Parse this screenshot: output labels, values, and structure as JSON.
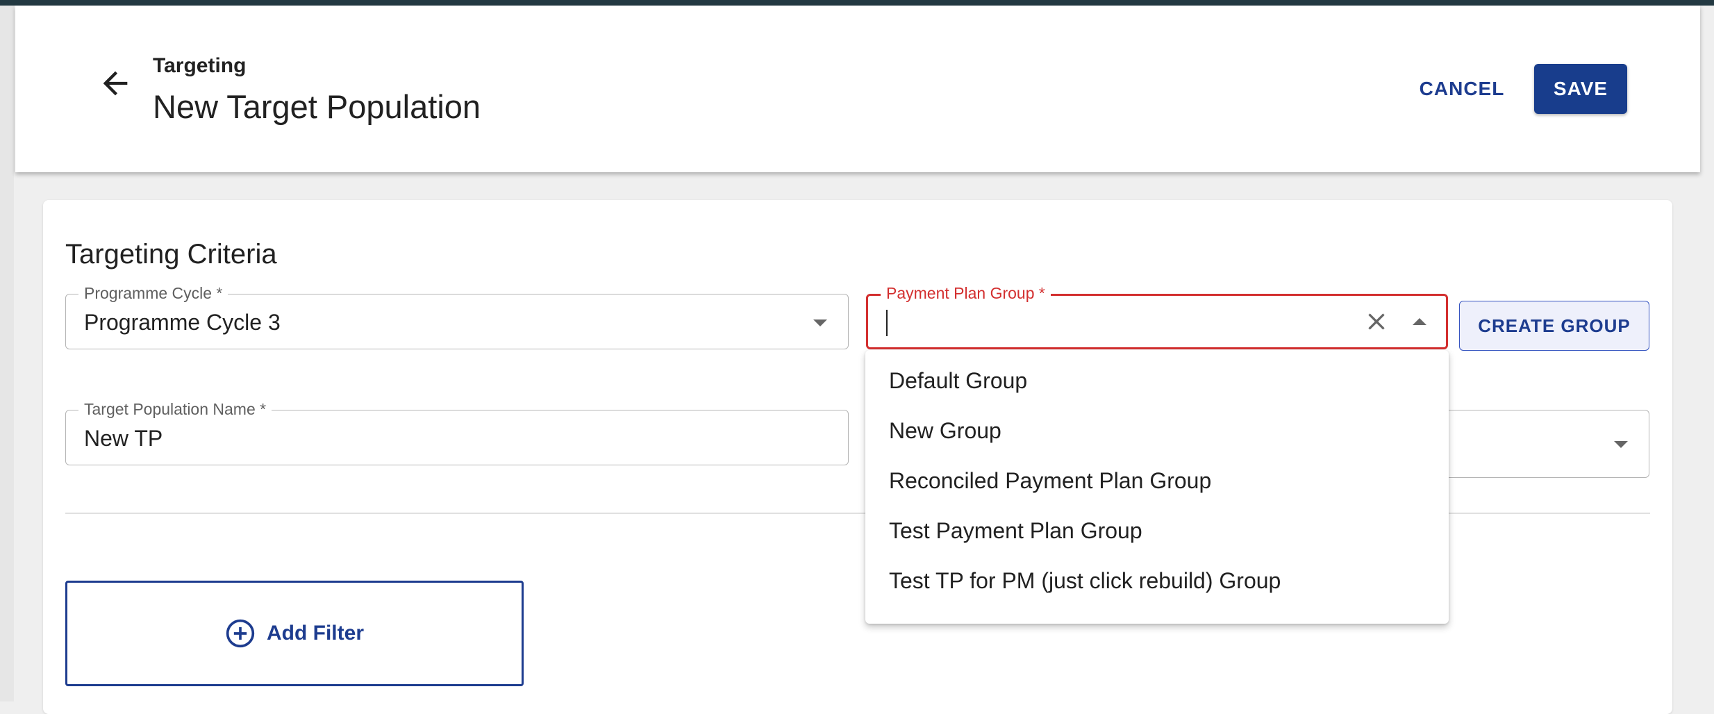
{
  "header": {
    "breadcrumb": "Targeting",
    "title": "New Target Population",
    "cancel_label": "CANCEL",
    "save_label": "SAVE",
    "back_icon": "arrow-left-icon"
  },
  "section": {
    "title": "Targeting Criteria"
  },
  "programme_cycle": {
    "label": "Programme Cycle *",
    "value": "Programme Cycle 3"
  },
  "payment_plan_group": {
    "label": "Payment Plan Group *",
    "value": "",
    "options": [
      "Default Group",
      "New Group",
      "Reconciled Payment Plan Group",
      "Test Payment Plan Group",
      "Test TP for PM (just click rebuild) Group"
    ]
  },
  "target_population_name": {
    "label": "Target Population Name *",
    "value": "New TP"
  },
  "create_group_label": "CREATE GROUP",
  "add_filter_label": "Add Filter",
  "colors": {
    "primary": "#1d3c8f",
    "error": "#d32f2f",
    "topbar": "#233942"
  }
}
